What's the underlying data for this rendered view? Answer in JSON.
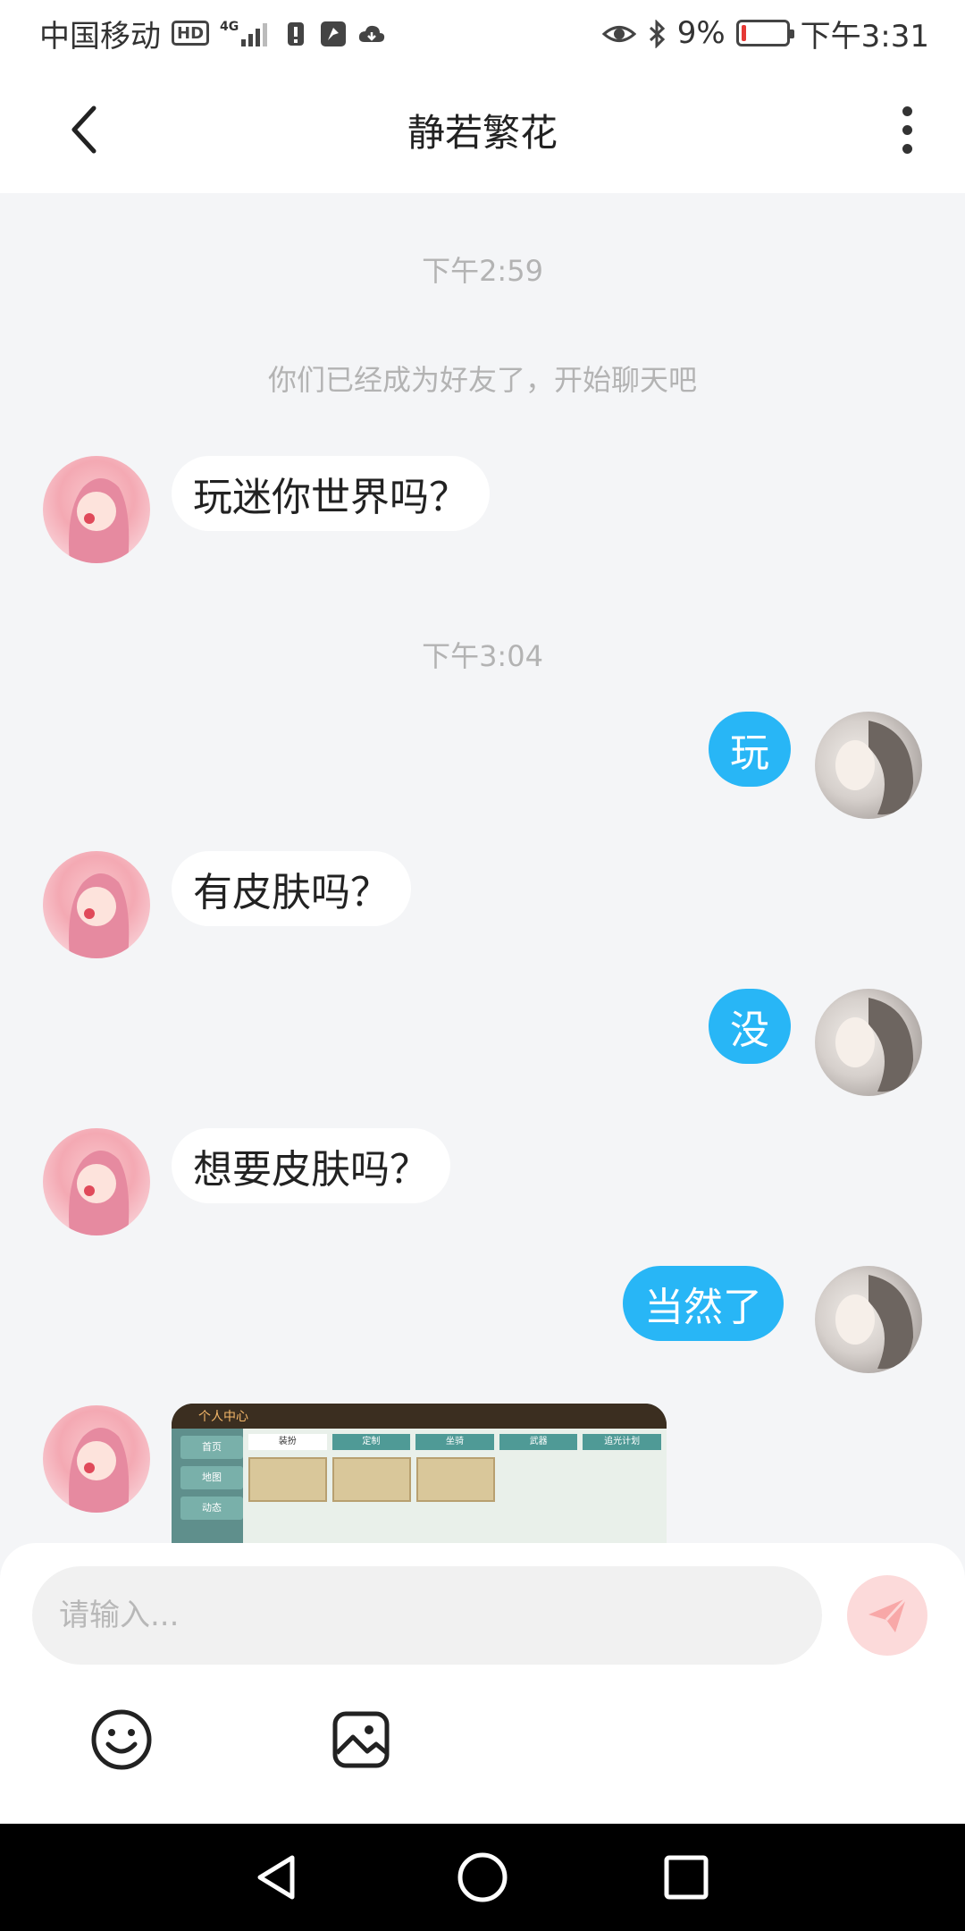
{
  "status_bar": {
    "carrier": "中国移动",
    "hd_badge": "HD",
    "network": "4G",
    "battery_percent": "9%",
    "battery_level": 0.09,
    "time": "下午3:31"
  },
  "header": {
    "title": "静若繁花"
  },
  "chat": {
    "timestamp_1": "下午2:59",
    "system_notice": "你们已经成为好友了，开始聊天吧",
    "timestamp_2": "下午3:04",
    "messages": [
      {
        "from": "friend",
        "text": "玩迷你世界吗？"
      },
      {
        "from": "self",
        "text": "玩"
      },
      {
        "from": "friend",
        "text": "有皮肤吗？"
      },
      {
        "from": "self",
        "text": "没"
      },
      {
        "from": "friend",
        "text": "想要皮肤吗？"
      },
      {
        "from": "self",
        "text": "当然了"
      },
      {
        "from": "friend",
        "type": "image"
      }
    ],
    "image_preview": {
      "title": "个人中心",
      "side_items": [
        "首页",
        "地图",
        "动态"
      ],
      "tabs": [
        "装扮",
        "定制",
        "坐骑",
        "武器",
        "追光计划"
      ]
    }
  },
  "input": {
    "placeholder": "请输入..."
  },
  "colors": {
    "accent": "#28b6f6",
    "background": "#f4f5f7",
    "send_disabled": "#fcdada"
  }
}
